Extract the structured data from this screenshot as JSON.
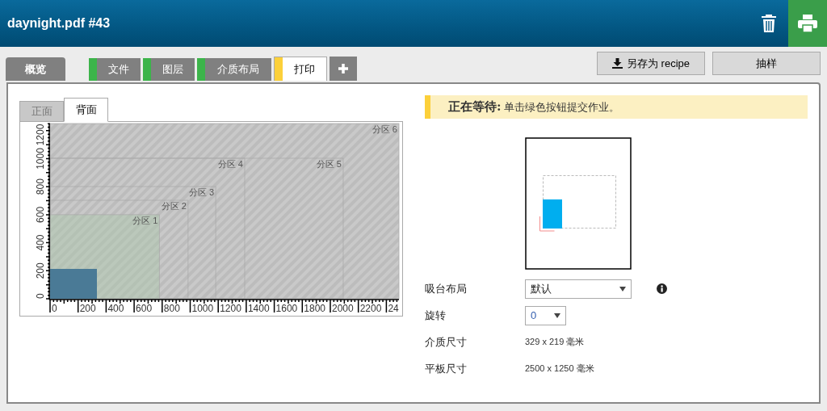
{
  "header": {
    "title": "daynight.pdf #43"
  },
  "tabs": [
    {
      "kind": "overview",
      "label": "概览",
      "selected": false
    },
    {
      "kind": "step",
      "label": "文件",
      "color": "#3cb44a",
      "selected": false
    },
    {
      "kind": "step",
      "label": "图层",
      "color": "#3cb44a",
      "selected": false
    },
    {
      "kind": "step",
      "label": "介质布局",
      "color": "#3cb44a",
      "selected": false
    },
    {
      "kind": "step",
      "label": "打印",
      "color": "#fcd03a",
      "selected": true
    },
    {
      "kind": "add",
      "selected": false
    }
  ],
  "toolbar_buttons": [
    {
      "kind": "save",
      "label": "另存为 recipe"
    },
    {
      "kind": "plain",
      "label": "抽样"
    }
  ],
  "side_tabs": [
    {
      "label": "正面",
      "selected": false
    },
    {
      "label": "背面",
      "selected": true
    }
  ],
  "bed": {
    "x_ticks": [
      "0",
      "200",
      "400",
      "600",
      "800",
      "1000",
      "1200",
      "1400",
      "1600",
      "1800",
      "2000",
      "2200",
      "24"
    ],
    "y_ticks": [
      "0",
      "200",
      "400",
      "600",
      "800",
      "1000",
      "1200"
    ],
    "zones": [
      {
        "label": "分区 1",
        "selected": true
      },
      {
        "label": "分区 2",
        "selected": false
      },
      {
        "label": "分区 3",
        "selected": false
      },
      {
        "label": "分区 4",
        "selected": false
      },
      {
        "label": "分区 5",
        "selected": false
      },
      {
        "label": "分区 6",
        "selected": false
      }
    ]
  },
  "status": {
    "title": "正在等待:",
    "message": "单击绿色按钮提交作业。"
  },
  "fields": [
    {
      "kind": "select",
      "label": "吸台布局",
      "value": "默认",
      "info": true
    },
    {
      "kind": "select",
      "label": "旋转",
      "value": "0"
    },
    {
      "kind": "text",
      "label": "介质尺寸",
      "value": "329 x 219 毫米"
    },
    {
      "kind": "text",
      "label": "平板尺寸",
      "value": "2500 x 1250 毫米"
    }
  ]
}
